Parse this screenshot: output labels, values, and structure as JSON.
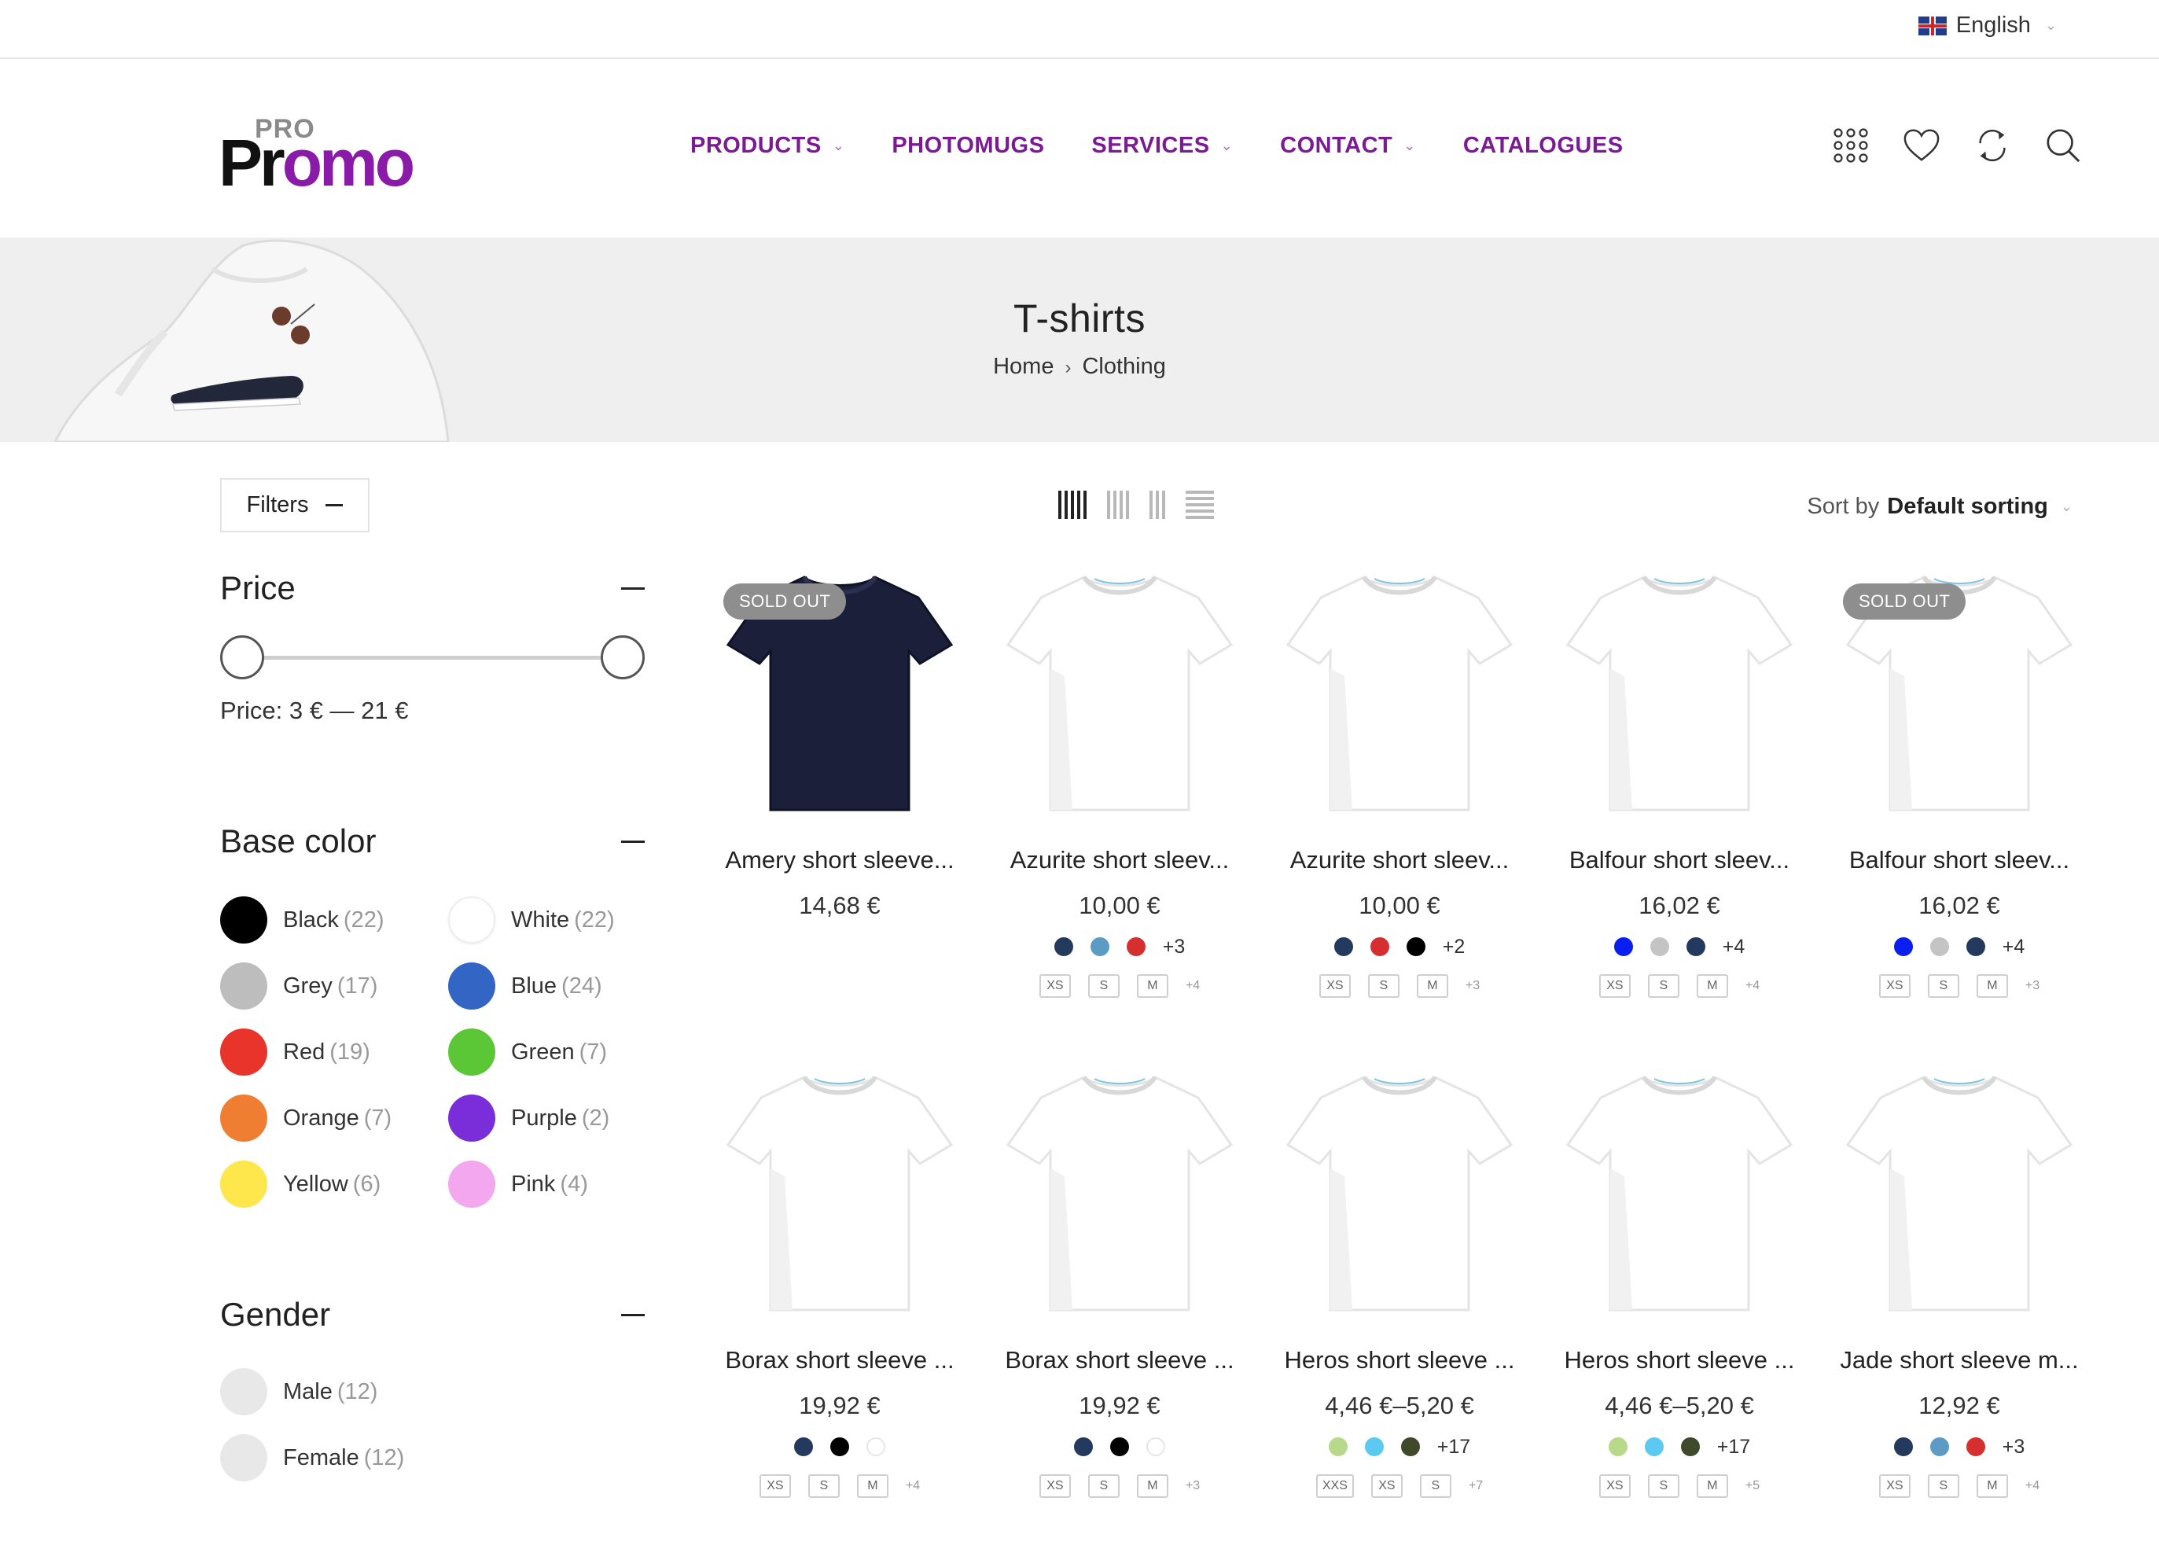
{
  "topbar": {
    "language": "English"
  },
  "logo": {
    "small": "PRO",
    "pr": "Pr",
    "omo": "omo"
  },
  "nav": [
    {
      "label": "PRODUCTS",
      "dropdown": true
    },
    {
      "label": "PHOTOMUGS",
      "dropdown": false
    },
    {
      "label": "SERVICES",
      "dropdown": true
    },
    {
      "label": "CONTACT",
      "dropdown": true
    },
    {
      "label": "CATALOGUES",
      "dropdown": false
    }
  ],
  "header_icons": [
    "grid-menu-icon",
    "heart-icon",
    "compare-icon",
    "search-icon"
  ],
  "banner": {
    "title": "T-shirts",
    "breadcrumb_home": "Home",
    "breadcrumb_current": "Clothing"
  },
  "toolbar": {
    "filters_label": "Filters",
    "sort_prefix": "Sort by",
    "sort_value": "Default sorting"
  },
  "price_filter": {
    "title": "Price",
    "label": "Price: 3 € — 21 €"
  },
  "color_filter": {
    "title": "Base color",
    "items": [
      {
        "name": "Black",
        "count": "(22)",
        "color": "#000000"
      },
      {
        "name": "White",
        "count": "(22)",
        "color": "#ffffff"
      },
      {
        "name": "Grey",
        "count": "(17)",
        "color": "#bdbdbd"
      },
      {
        "name": "Blue",
        "count": "(24)",
        "color": "#3366c4"
      },
      {
        "name": "Red",
        "count": "(19)",
        "color": "#e8342a"
      },
      {
        "name": "Green",
        "count": "(7)",
        "color": "#5bc636"
      },
      {
        "name": "Orange",
        "count": "(7)",
        "color": "#ef7d32"
      },
      {
        "name": "Purple",
        "count": "(2)",
        "color": "#7a2ed9"
      },
      {
        "name": "Yellow",
        "count": "(6)",
        "color": "#fde74c"
      },
      {
        "name": "Pink",
        "count": "(4)",
        "color": "#f3a7ef"
      }
    ]
  },
  "gender_filter": {
    "title": "Gender",
    "items": [
      {
        "name": "Male",
        "count": "(12)"
      },
      {
        "name": "Female",
        "count": "(12)"
      }
    ]
  },
  "products": [
    {
      "name": "Amery short sleeve...",
      "price": "14,68 €",
      "badge": "SOLD OUT",
      "shirt": "#1c1f3a",
      "swatches": [],
      "swatch_more": "",
      "sizes": [],
      "size_more": ""
    },
    {
      "name": "Azurite short sleev...",
      "price": "10,00 €",
      "badge": "",
      "shirt": "#ffffff",
      "swatches": [
        "#23395d",
        "#5b9bc4",
        "#d62f2f"
      ],
      "swatch_more": "+3",
      "sizes": [
        "XS",
        "S",
        "M"
      ],
      "size_more": "+4"
    },
    {
      "name": "Azurite short sleev...",
      "price": "10,00 €",
      "badge": "",
      "shirt": "#ffffff",
      "swatches": [
        "#23395d",
        "#d62f2f",
        "#000000"
      ],
      "swatch_more": "+2",
      "sizes": [
        "XS",
        "S",
        "M"
      ],
      "size_more": "+3"
    },
    {
      "name": "Balfour short sleev...",
      "price": "16,02 €",
      "badge": "",
      "shirt": "#ffffff",
      "swatches": [
        "#0a1ef0",
        "#c4c4c4",
        "#23395d"
      ],
      "swatch_more": "+4",
      "sizes": [
        "XS",
        "S",
        "M"
      ],
      "size_more": "+4"
    },
    {
      "name": "Balfour short sleev...",
      "price": "16,02 €",
      "badge": "SOLD OUT",
      "shirt": "#ffffff",
      "swatches": [
        "#0a1ef0",
        "#c4c4c4",
        "#23395d"
      ],
      "swatch_more": "+4",
      "sizes": [
        "XS",
        "S",
        "M"
      ],
      "size_more": "+3"
    },
    {
      "name": "Borax short sleeve ...",
      "price": "19,92 €",
      "badge": "",
      "shirt": "#ffffff",
      "swatches": [
        "#23395d",
        "#000000",
        "#ffffff"
      ],
      "swatch_more": "",
      "sizes": [
        "XS",
        "S",
        "M"
      ],
      "size_more": "+4"
    },
    {
      "name": "Borax short sleeve ...",
      "price": "19,92 €",
      "badge": "",
      "shirt": "#ffffff",
      "swatches": [
        "#23395d",
        "#000000",
        "#ffffff"
      ],
      "swatch_more": "",
      "sizes": [
        "XS",
        "S",
        "M"
      ],
      "size_more": "+3"
    },
    {
      "name": "Heros short sleeve ...",
      "price": "4,46 €–5,20 €",
      "badge": "",
      "shirt": "#ffffff",
      "swatches": [
        "#b9d98a",
        "#5bc9f0",
        "#3f4a2a"
      ],
      "swatch_more": "+17",
      "sizes": [
        "XXS",
        "XS",
        "S"
      ],
      "size_more": "+7"
    },
    {
      "name": "Heros short sleeve ...",
      "price": "4,46 €–5,20 €",
      "badge": "",
      "shirt": "#ffffff",
      "swatches": [
        "#b9d98a",
        "#5bc9f0",
        "#3f4a2a"
      ],
      "swatch_more": "+17",
      "sizes": [
        "XS",
        "S",
        "M"
      ],
      "size_more": "+5"
    },
    {
      "name": "Jade short sleeve m...",
      "price": "12,92 €",
      "badge": "",
      "shirt": "#ffffff",
      "swatches": [
        "#23395d",
        "#5b9bc4",
        "#d62f2f"
      ],
      "swatch_more": "+3",
      "sizes": [
        "XS",
        "S",
        "M"
      ],
      "size_more": "+4"
    }
  ]
}
